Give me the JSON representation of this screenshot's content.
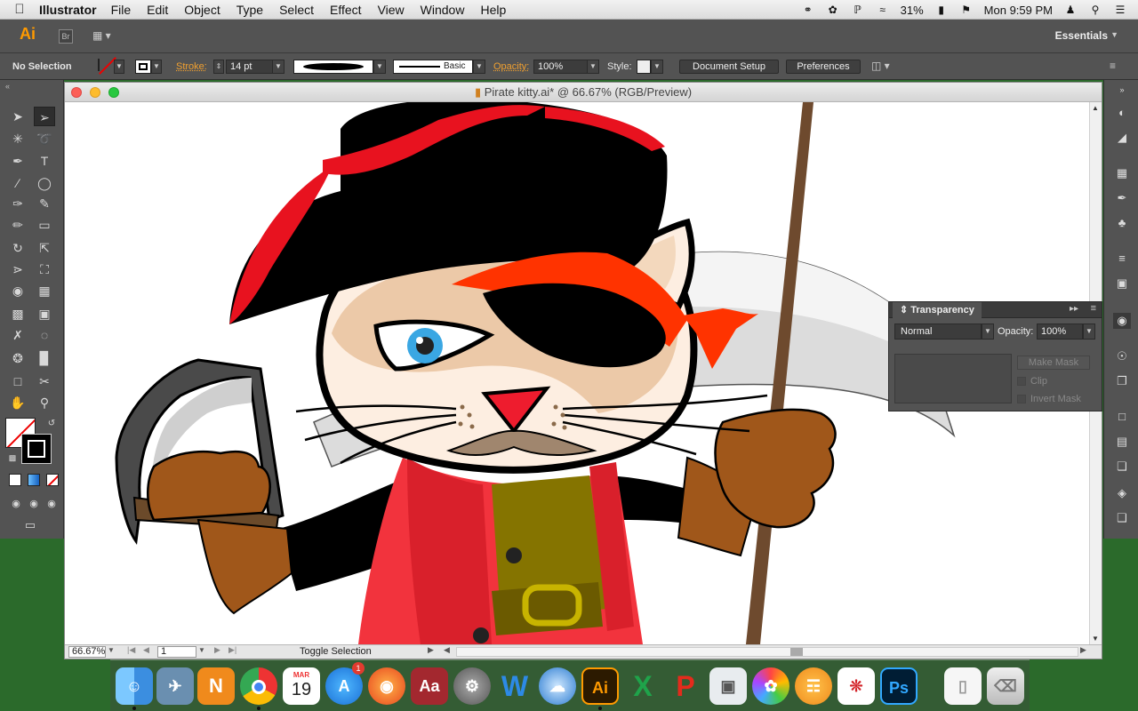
{
  "menubar": {
    "app_name": "Illustrator",
    "menus": [
      "File",
      "Edit",
      "Object",
      "Type",
      "Select",
      "Effect",
      "View",
      "Window",
      "Help"
    ],
    "battery": "31%",
    "clock": "Mon 9:59 PM"
  },
  "appbar": {
    "logo": "Ai",
    "bridge": "Br",
    "workspace": "Essentials"
  },
  "controlbar": {
    "selection": "No Selection",
    "stroke_label": "Stroke:",
    "stroke_value": "14 pt",
    "stroke_style": "Basic",
    "opacity_label": "Opacity:",
    "opacity_value": "100%",
    "style_label": "Style:",
    "document_setup": "Document Setup",
    "preferences": "Preferences"
  },
  "document": {
    "title": "Pirate kitty.ai* @ 66.67% (RGB/Preview)",
    "zoom": "66.67%",
    "artboard": "1",
    "status": "Toggle Selection"
  },
  "transparency": {
    "tab": "Transparency",
    "blend_mode": "Normal",
    "opacity_label": "Opacity:",
    "opacity_value": "100%",
    "make_mask": "Make Mask",
    "clip": "Clip",
    "invert_mask": "Invert Mask"
  },
  "dock": {
    "calendar_month": "MAR",
    "calendar_day": "19",
    "appstore_badge": "1"
  },
  "colors": {
    "accent_orange": "#ff9a00",
    "hat_red": "#e8121f",
    "coat_red": "#f2333d",
    "bandana": "#ff3300",
    "glove_brown": "#a0571a"
  }
}
